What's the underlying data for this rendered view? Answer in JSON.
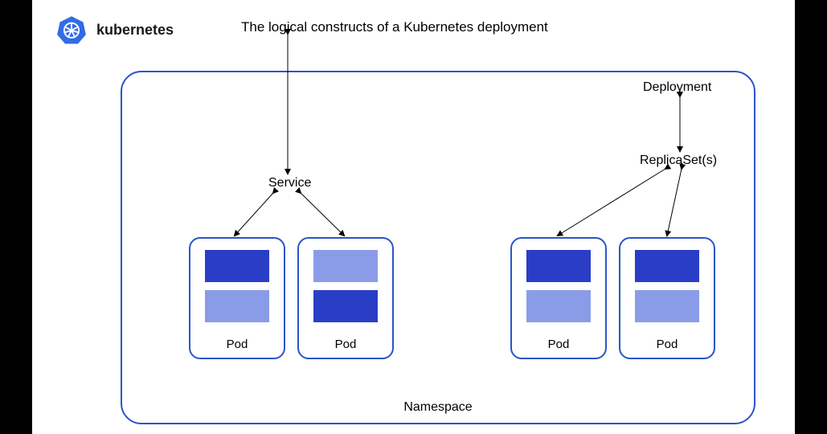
{
  "brand": "kubernetes",
  "title": "The logical constructs of a Kubernetes deployment",
  "labels": {
    "deployment": "Deployment",
    "replicaset": "ReplicaSet(s)",
    "service": "Service",
    "namespace": "Namespace",
    "pod": "Pod"
  },
  "pods": [
    {
      "id": "pod1",
      "containers": [
        "dark",
        "light"
      ]
    },
    {
      "id": "pod2",
      "containers": [
        "light",
        "dark"
      ]
    },
    {
      "id": "pod3",
      "containers": [
        "dark",
        "light"
      ]
    },
    {
      "id": "pod4",
      "containers": [
        "dark",
        "light"
      ]
    }
  ]
}
